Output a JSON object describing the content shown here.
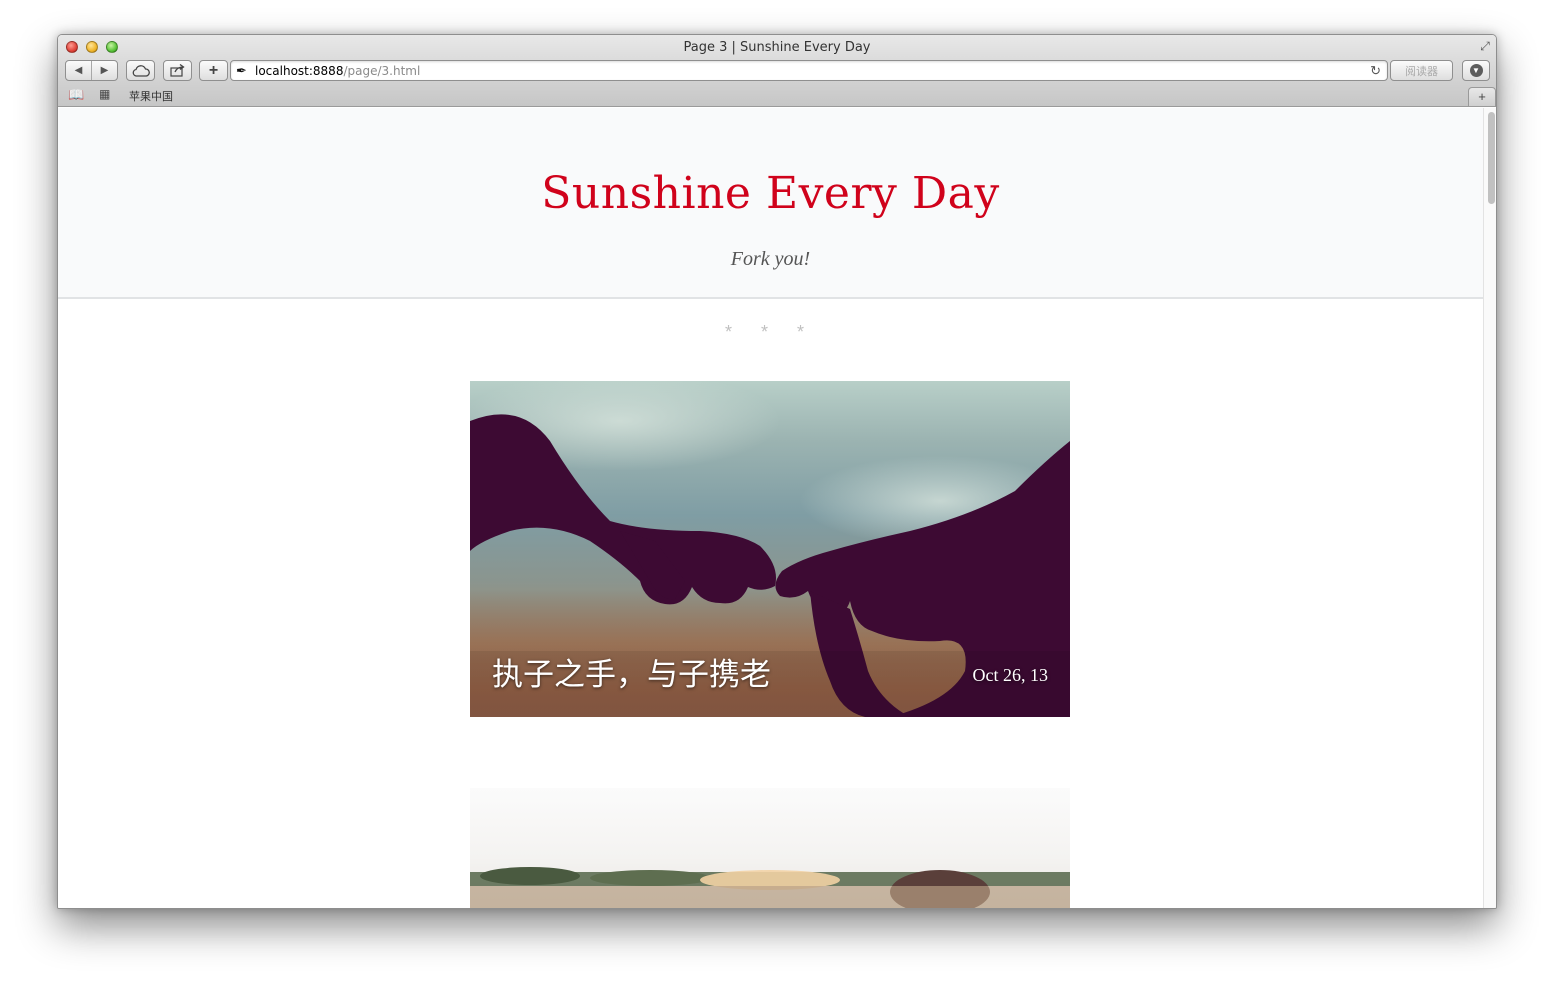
{
  "window": {
    "title": "Page 3 | Sunshine Every Day"
  },
  "toolbar": {
    "url_host": "localhost:8888",
    "url_path": "/page/3.html",
    "reader_label": "阅读器",
    "plus_label": "+"
  },
  "bookmarks": {
    "items": [
      {
        "label": "苹果中国"
      }
    ],
    "newtab_label": "+"
  },
  "site": {
    "title": "Sunshine Every Day",
    "subtitle": "Fork you!",
    "divider": "* * *"
  },
  "posts": [
    {
      "title": "执子之手，与子携老",
      "date": "Oct 26, 13"
    }
  ],
  "colors": {
    "title_red": "#d0021b",
    "header_bg": "#f9fafb"
  }
}
